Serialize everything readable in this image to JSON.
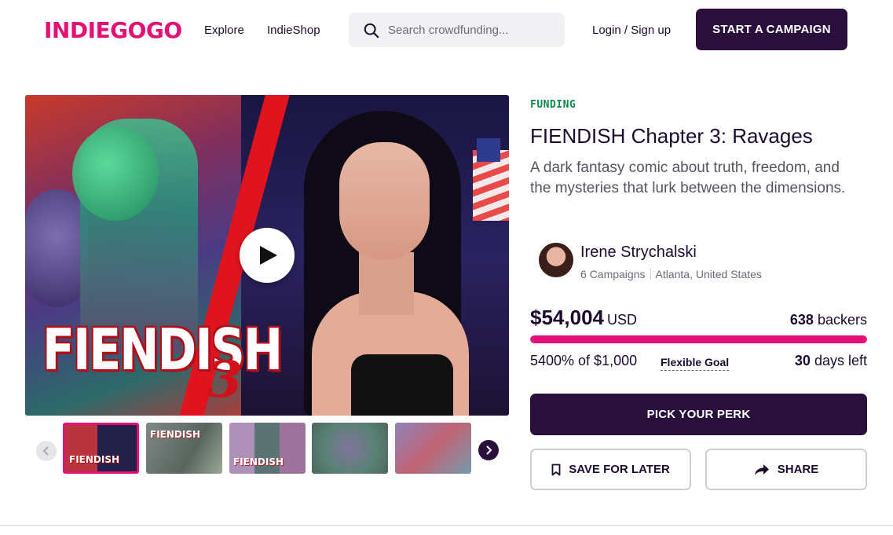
{
  "header": {
    "logo": "INDIEGOGO",
    "nav": {
      "explore": "Explore",
      "indieshop": "IndieShop"
    },
    "search_placeholder": "Search crowdfunding...",
    "login": "Login / Sign up",
    "start_campaign": "START A CAMPAIGN"
  },
  "media": {
    "title_text": "FIENDISH",
    "title_number": "3"
  },
  "thumbnails": [
    {
      "label": "FIENDISH",
      "active": true
    },
    {
      "label": "FIENDISH",
      "active": false
    },
    {
      "label": "FIENDISH",
      "active": false
    },
    {
      "label": "",
      "active": false
    },
    {
      "label": "",
      "active": false
    }
  ],
  "campaign": {
    "status": "FUNDING",
    "title": "FIENDISH Chapter 3: Ravages",
    "subtitle": "A dark fantasy comic about truth, freedom, and the mysteries that lurk between the dimensions."
  },
  "creator": {
    "name": "Irene Strychalski",
    "campaigns": "6 Campaigns",
    "location": "Atlanta, United States"
  },
  "funding": {
    "amount": "$54,004",
    "currency": "USD",
    "backers_count": "638",
    "backers_label": "backers",
    "progress_fraction": 1.0,
    "percent_text": "5400% of $1,000",
    "goal_type": "Flexible Goal",
    "days_count": "30",
    "days_label": "days left"
  },
  "actions": {
    "pick_perk": "PICK YOUR PERK",
    "save": "SAVE FOR LATER",
    "share": "SHARE"
  },
  "colors": {
    "brand": "#e51075",
    "primary_button": "#2a0f3c",
    "funding_status": "#0d8a4a"
  }
}
